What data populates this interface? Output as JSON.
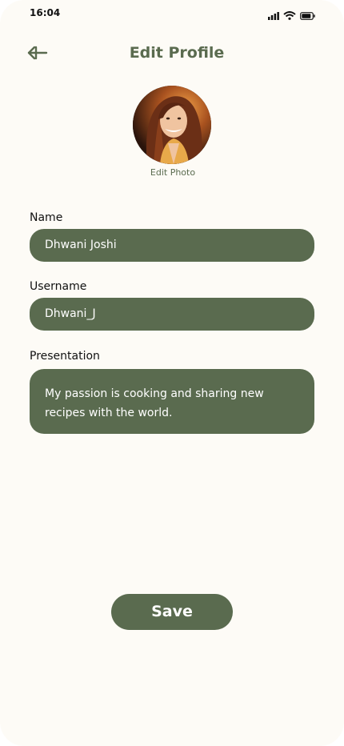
{
  "status_bar": {
    "time": "16:04",
    "icons": [
      "cellular-signal-icon",
      "wifi-icon",
      "battery-icon"
    ]
  },
  "header": {
    "back_icon": "arrow-left-icon",
    "title": "Edit Profile"
  },
  "profile": {
    "edit_photo_label": "Edit Photo"
  },
  "form": {
    "name": {
      "label": "Name",
      "value": "Dhwani Joshi"
    },
    "username": {
      "label": "Username",
      "value": "Dhwani_J"
    },
    "presentation": {
      "label": "Presentation",
      "value": "My passion is cooking and sharing new recipes with the world."
    }
  },
  "actions": {
    "save_label": "Save"
  },
  "colors": {
    "accent": "#5a6b4f",
    "background": "#fdfbf6",
    "field_text": "#ffffff"
  }
}
